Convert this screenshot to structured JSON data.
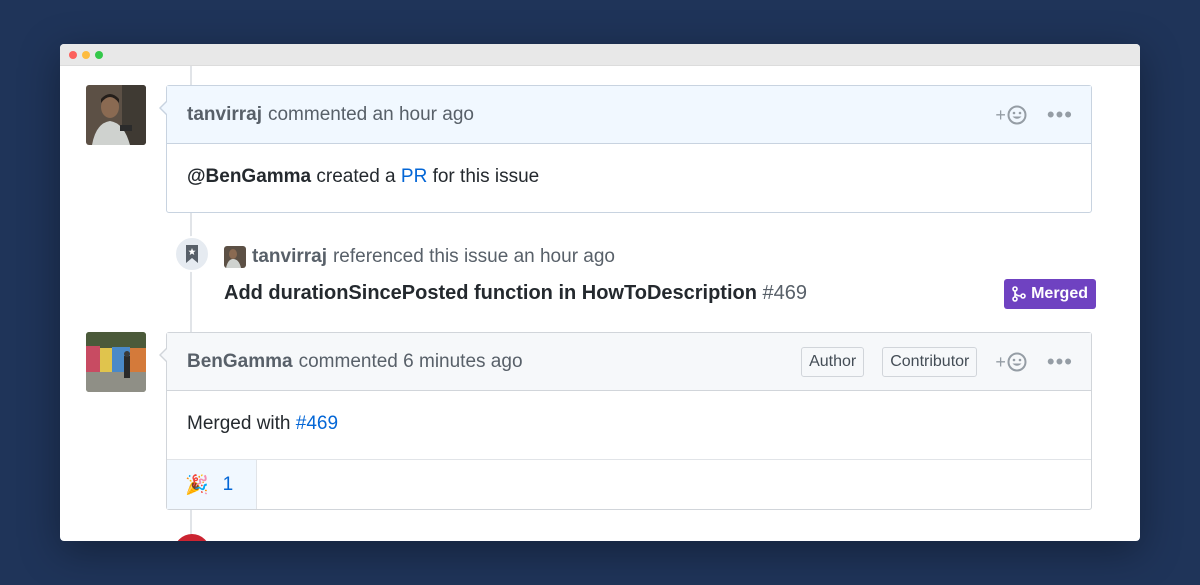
{
  "comments": [
    {
      "author": "tanvirraj",
      "meta": "commented an hour ago",
      "body_mention": "@BenGamma",
      "body_mid": " created a ",
      "body_link": "PR",
      "body_end": " for this issue"
    },
    {
      "author": "BenGamma",
      "meta": "commented 6 minutes ago",
      "labels": [
        "Author",
        "Contributor"
      ],
      "body_text": "Merged with ",
      "body_link": "#469",
      "reaction_emoji": "🎉",
      "reaction_count": "1"
    }
  ],
  "reference": {
    "author": "tanvirraj",
    "meta": "referenced this issue an hour ago",
    "title": "Add durationSincePosted function in HowToDescription",
    "number": "#469",
    "status": "Merged"
  },
  "actions": {
    "add_reaction": "+",
    "more": "•••"
  },
  "colors": {
    "background": "#1f3459",
    "merged": "#6f42c1",
    "link": "#0366d6"
  }
}
